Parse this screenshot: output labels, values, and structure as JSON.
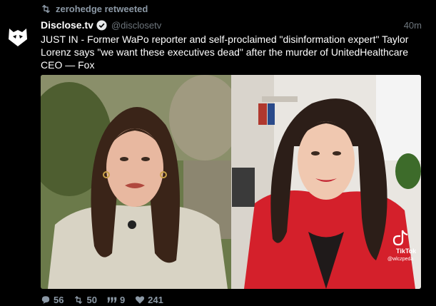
{
  "retweet": {
    "label": "zerohedge retweeted",
    "icon": "retweet-icon"
  },
  "author": {
    "display_name": "Disclose.tv",
    "handle": "@disclosetv",
    "verified": true,
    "avatar_icon": "disclose-logo-icon"
  },
  "timestamp": "40m",
  "tweet": {
    "text": "JUST IN - Former WaPo reporter and self-proclaimed \"disinformation expert\" Taylor Lorenz says \"we want these executives dead\" after the murder of UnitedHealthcare CEO — Fox"
  },
  "media": {
    "left_panel": "woman in cream sweater outdoors",
    "right_panel": "woman in red blazer indoors",
    "watermark_brand": "TikTok",
    "watermark_handle": "@wlczpeda"
  },
  "actions": {
    "replies": "56",
    "retweets": "50",
    "quotes": "9",
    "likes": "241"
  },
  "colors": {
    "background": "#000000",
    "muted": "#8b98a5",
    "verified_badge": "#1d9bf0",
    "red_blazer": "#d4202b"
  }
}
